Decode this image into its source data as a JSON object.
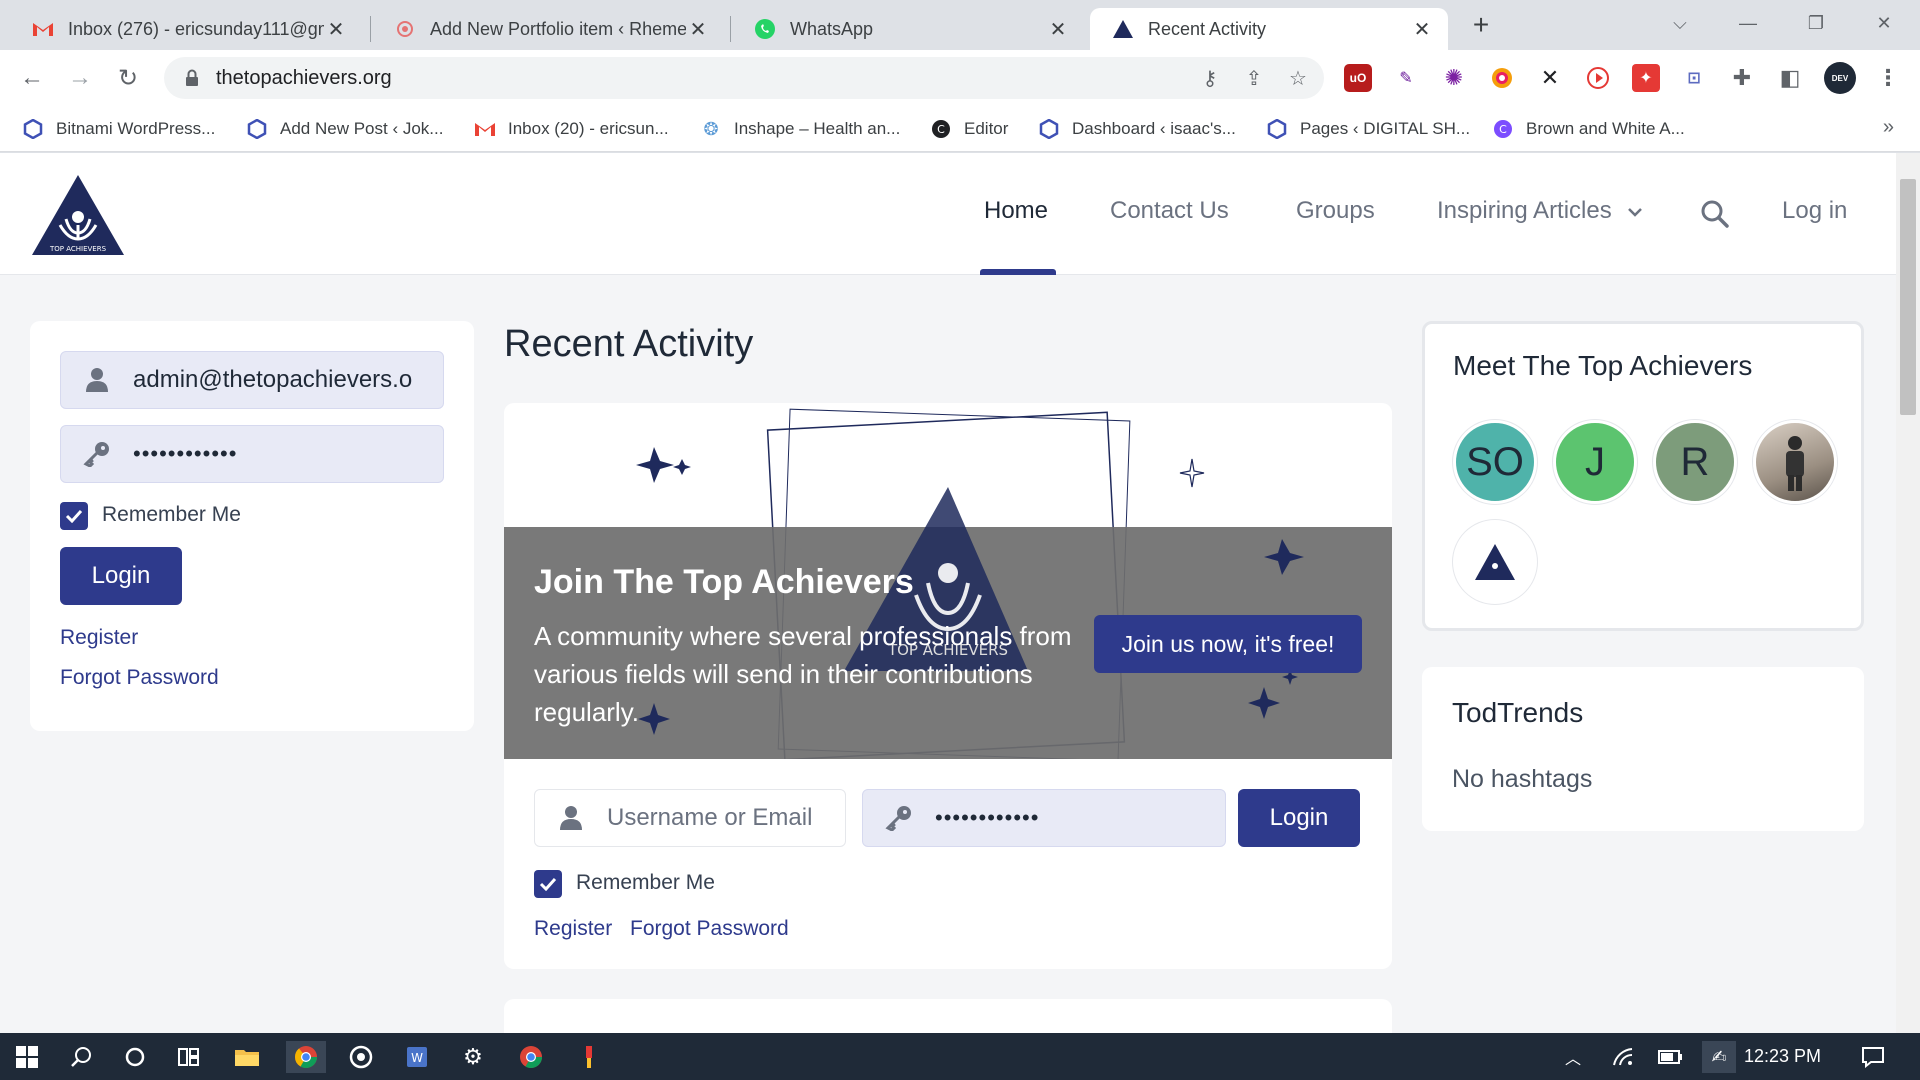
{
  "browser": {
    "tabs": [
      {
        "title": "Inbox (276) - ericsunday111@gm",
        "icon": "gmail-icon"
      },
      {
        "title": "Add New Portfolio item ‹ Rheme",
        "icon": "portfolio-icon"
      },
      {
        "title": "WhatsApp",
        "icon": "whatsapp-icon"
      },
      {
        "title": "Recent Activity",
        "icon": "top-achievers-icon"
      }
    ],
    "url": "thetopachievers.org",
    "bookmarks": [
      {
        "label": "Bitnami WordPress...",
        "icon": "wordpress-icon"
      },
      {
        "label": "Add New Post ‹ Jok...",
        "icon": "wordpress-icon"
      },
      {
        "label": "Inbox (20) - ericsun...",
        "icon": "gmail-icon"
      },
      {
        "label": "Inshape – Health an...",
        "icon": "inshape-icon"
      },
      {
        "label": "Editor",
        "icon": "editor-icon"
      },
      {
        "label": "Dashboard ‹ isaac's...",
        "icon": "wordpress-icon"
      },
      {
        "label": "Pages ‹ DIGITAL SH...",
        "icon": "wordpress-icon"
      },
      {
        "label": "Brown and White A...",
        "icon": "canva-icon"
      }
    ],
    "more_bookmarks": "»"
  },
  "site": {
    "nav": {
      "home": "Home",
      "contact": "Contact Us",
      "groups": "Groups",
      "articles": "Inspiring Articles",
      "login": "Log in"
    },
    "logo_text": "TOP ACHIEVERS"
  },
  "sidebar_login": {
    "username": "admin@thetopachievers.o",
    "password": "••••••••••••",
    "remember": "Remember Me",
    "login": "Login",
    "register": "Register",
    "forgot": "Forgot Password"
  },
  "main": {
    "title": "Recent Activity",
    "hero": {
      "heading": "Join The Top Achievers",
      "description": "A community where several professionals from various fields will send in their contributions regularly.",
      "cta": "Join us now, it's free!",
      "logo_text": "TOP ACHIEVERS"
    },
    "login": {
      "username_placeholder": "Username or Email",
      "password": "••••••••••••",
      "login": "Login",
      "remember": "Remember Me",
      "register": "Register",
      "forgot": "Forgot Password"
    }
  },
  "right": {
    "members_title": "Meet The Top Achievers",
    "members": [
      {
        "initials": "SO",
        "color": "#4fb3aa"
      },
      {
        "initials": "J",
        "color": "#5cc46f"
      },
      {
        "initials": "R",
        "color": "#7d9c7b"
      }
    ],
    "trends_title": "TodTrends",
    "trends_empty": "No hashtags"
  },
  "taskbar": {
    "time": "12:23 PM"
  },
  "colors": {
    "brand": "#2e3a8c",
    "hero_band": "#6e6e6e"
  }
}
